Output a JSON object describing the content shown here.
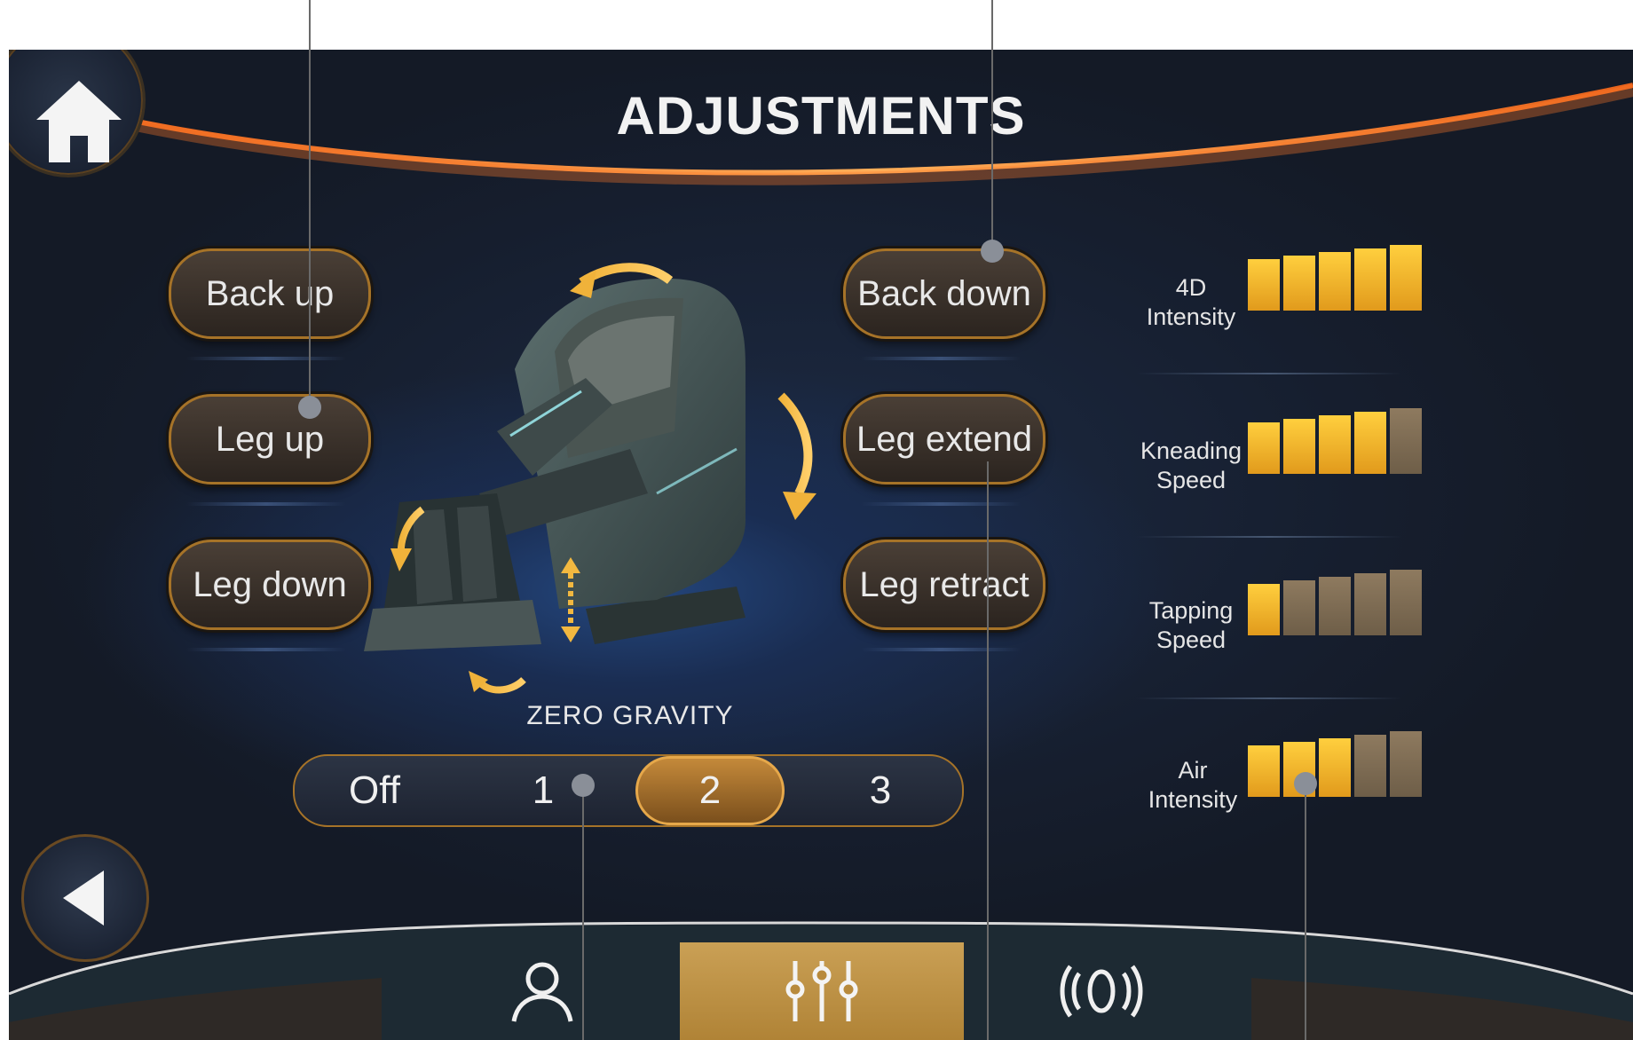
{
  "header": {
    "title": "ADJUSTMENTS"
  },
  "icons": {
    "home": "home-icon",
    "back": "back-arrow-icon",
    "profile": "user-icon",
    "adjust": "sliders-icon",
    "vibration": "vibration-icon"
  },
  "colors": {
    "accent": "#e6a84a",
    "level_on": "#f5b52a",
    "level_off": "#7e6c54",
    "nav_active": "#c0924a"
  },
  "left_buttons": [
    {
      "label": "Back up"
    },
    {
      "label": "Leg up"
    },
    {
      "label": "Leg down"
    }
  ],
  "right_buttons": [
    {
      "label": "Back down"
    },
    {
      "label": "Leg extend"
    },
    {
      "label": "Leg retract"
    }
  ],
  "zero_gravity": {
    "label": "ZERO GRAVITY",
    "options": [
      "Off",
      "1",
      "2",
      "3"
    ],
    "selected": "2"
  },
  "levels": [
    {
      "label_line1": "4D",
      "label_line2": "Intensity",
      "value": 5,
      "max": 5
    },
    {
      "label_line1": "Kneading",
      "label_line2": "Speed",
      "value": 4,
      "max": 5
    },
    {
      "label_line1": "Tapping",
      "label_line2": "Speed",
      "value": 1,
      "max": 5
    },
    {
      "label_line1": "Air",
      "label_line2": "Intensity",
      "value": 3,
      "max": 5
    }
  ],
  "nav": {
    "active_tab": "adjust"
  }
}
